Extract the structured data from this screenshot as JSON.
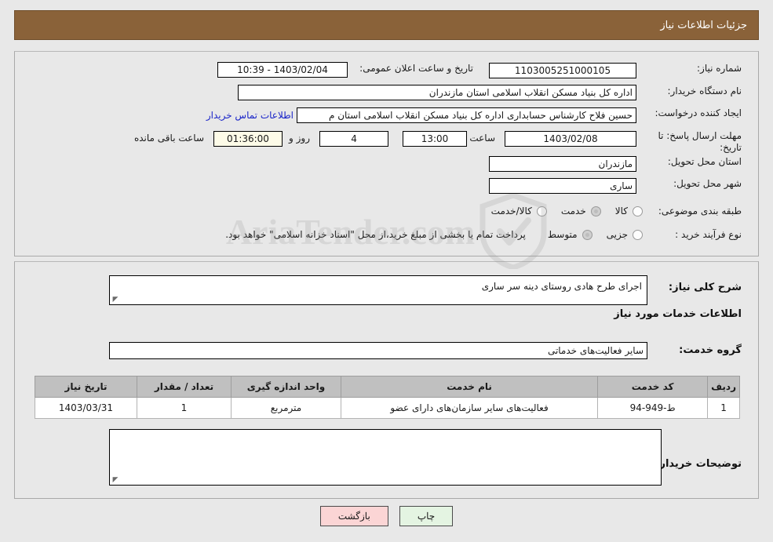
{
  "header": {
    "title": "جزئیات اطلاعات نیاز"
  },
  "watermark": {
    "text": "AriaTender.com",
    "icon": "shield-icon"
  },
  "top_panel": {
    "need_number_label": "شماره نیاز:",
    "need_number_value": "1103005251000105",
    "announce_label": "تاریخ و ساعت اعلان عمومی:",
    "announce_value": "1403/02/04 - 10:39",
    "buyer_org_label": "نام دستگاه خریدار:",
    "buyer_org_value": "اداره کل بنیاد مسکن انقلاب اسلامی استان مازندران",
    "creator_label": "ایجاد کننده درخواست:",
    "creator_value": "حسین فلاح کارشناس حسابداری اداره کل بنیاد مسکن انقلاب اسلامی استان م",
    "contact_link": "اطلاعات تماس خریدار",
    "deadline_label": "مهلت ارسال پاسخ: تا تاریخ:",
    "deadline_date": "1403/02/08",
    "deadline_hour_label": "ساعت",
    "deadline_hour": "13:00",
    "days_remaining": "4",
    "days_label": "روز و",
    "time_remaining": "01:36:00",
    "remaining_suffix": "ساعت باقی مانده",
    "province_label": "استان محل تحویل:",
    "province_value": "مازندران",
    "city_label": "شهر محل تحویل:",
    "city_value": "ساری",
    "category_label": "طبقه بندی موضوعی:",
    "category_options": [
      {
        "label": "کالا",
        "selected": false
      },
      {
        "label": "خدمت",
        "selected": true
      },
      {
        "label": "کالا/خدمت",
        "selected": false
      }
    ],
    "process_label": "نوع فرآیند خرید :",
    "process_options": [
      {
        "label": "جزیی",
        "selected": false
      },
      {
        "label": "متوسط",
        "selected": true
      }
    ],
    "payment_note": "پرداخت تمام یا بخشی از مبلغ خرید،از محل \"اسناد خزانه اسلامی\" خواهد بود."
  },
  "mid_panel": {
    "general_desc_label": "شرح کلی نیاز:",
    "general_desc_value": "اجرای طرح هادی روستای دینه سر ساری",
    "services_heading": "اطلاعات خدمات مورد نیاز",
    "service_group_label": "گروه خدمت:",
    "service_group_value": "سایر فعالیت‌های خدماتی",
    "buyer_notes_label": "توضیحات خریدار:",
    "buyer_notes_value": ""
  },
  "table": {
    "columns": [
      "ردیف",
      "کد خدمت",
      "نام خدمت",
      "واحد اندازه گیری",
      "تعداد / مقدار",
      "تاریخ نیاز"
    ],
    "rows": [
      {
        "index": "1",
        "service_code": "ط-949-94",
        "service_name": "فعالیت‌های سایر سازمان‌های دارای عضو",
        "unit": "مترمربع",
        "quantity": "1",
        "need_date": "1403/03/31"
      }
    ]
  },
  "footer": {
    "print_label": "چاپ",
    "back_label": "بازگشت"
  },
  "colors": {
    "header_bar": "#8a6239",
    "page_bg": "#e8e8e8",
    "link": "#1a25c8",
    "table_header": "#c0c0c0",
    "print_btn": "#e4f4e2",
    "back_btn": "#fbd5d5",
    "highlight_field": "#fdfbe8"
  }
}
